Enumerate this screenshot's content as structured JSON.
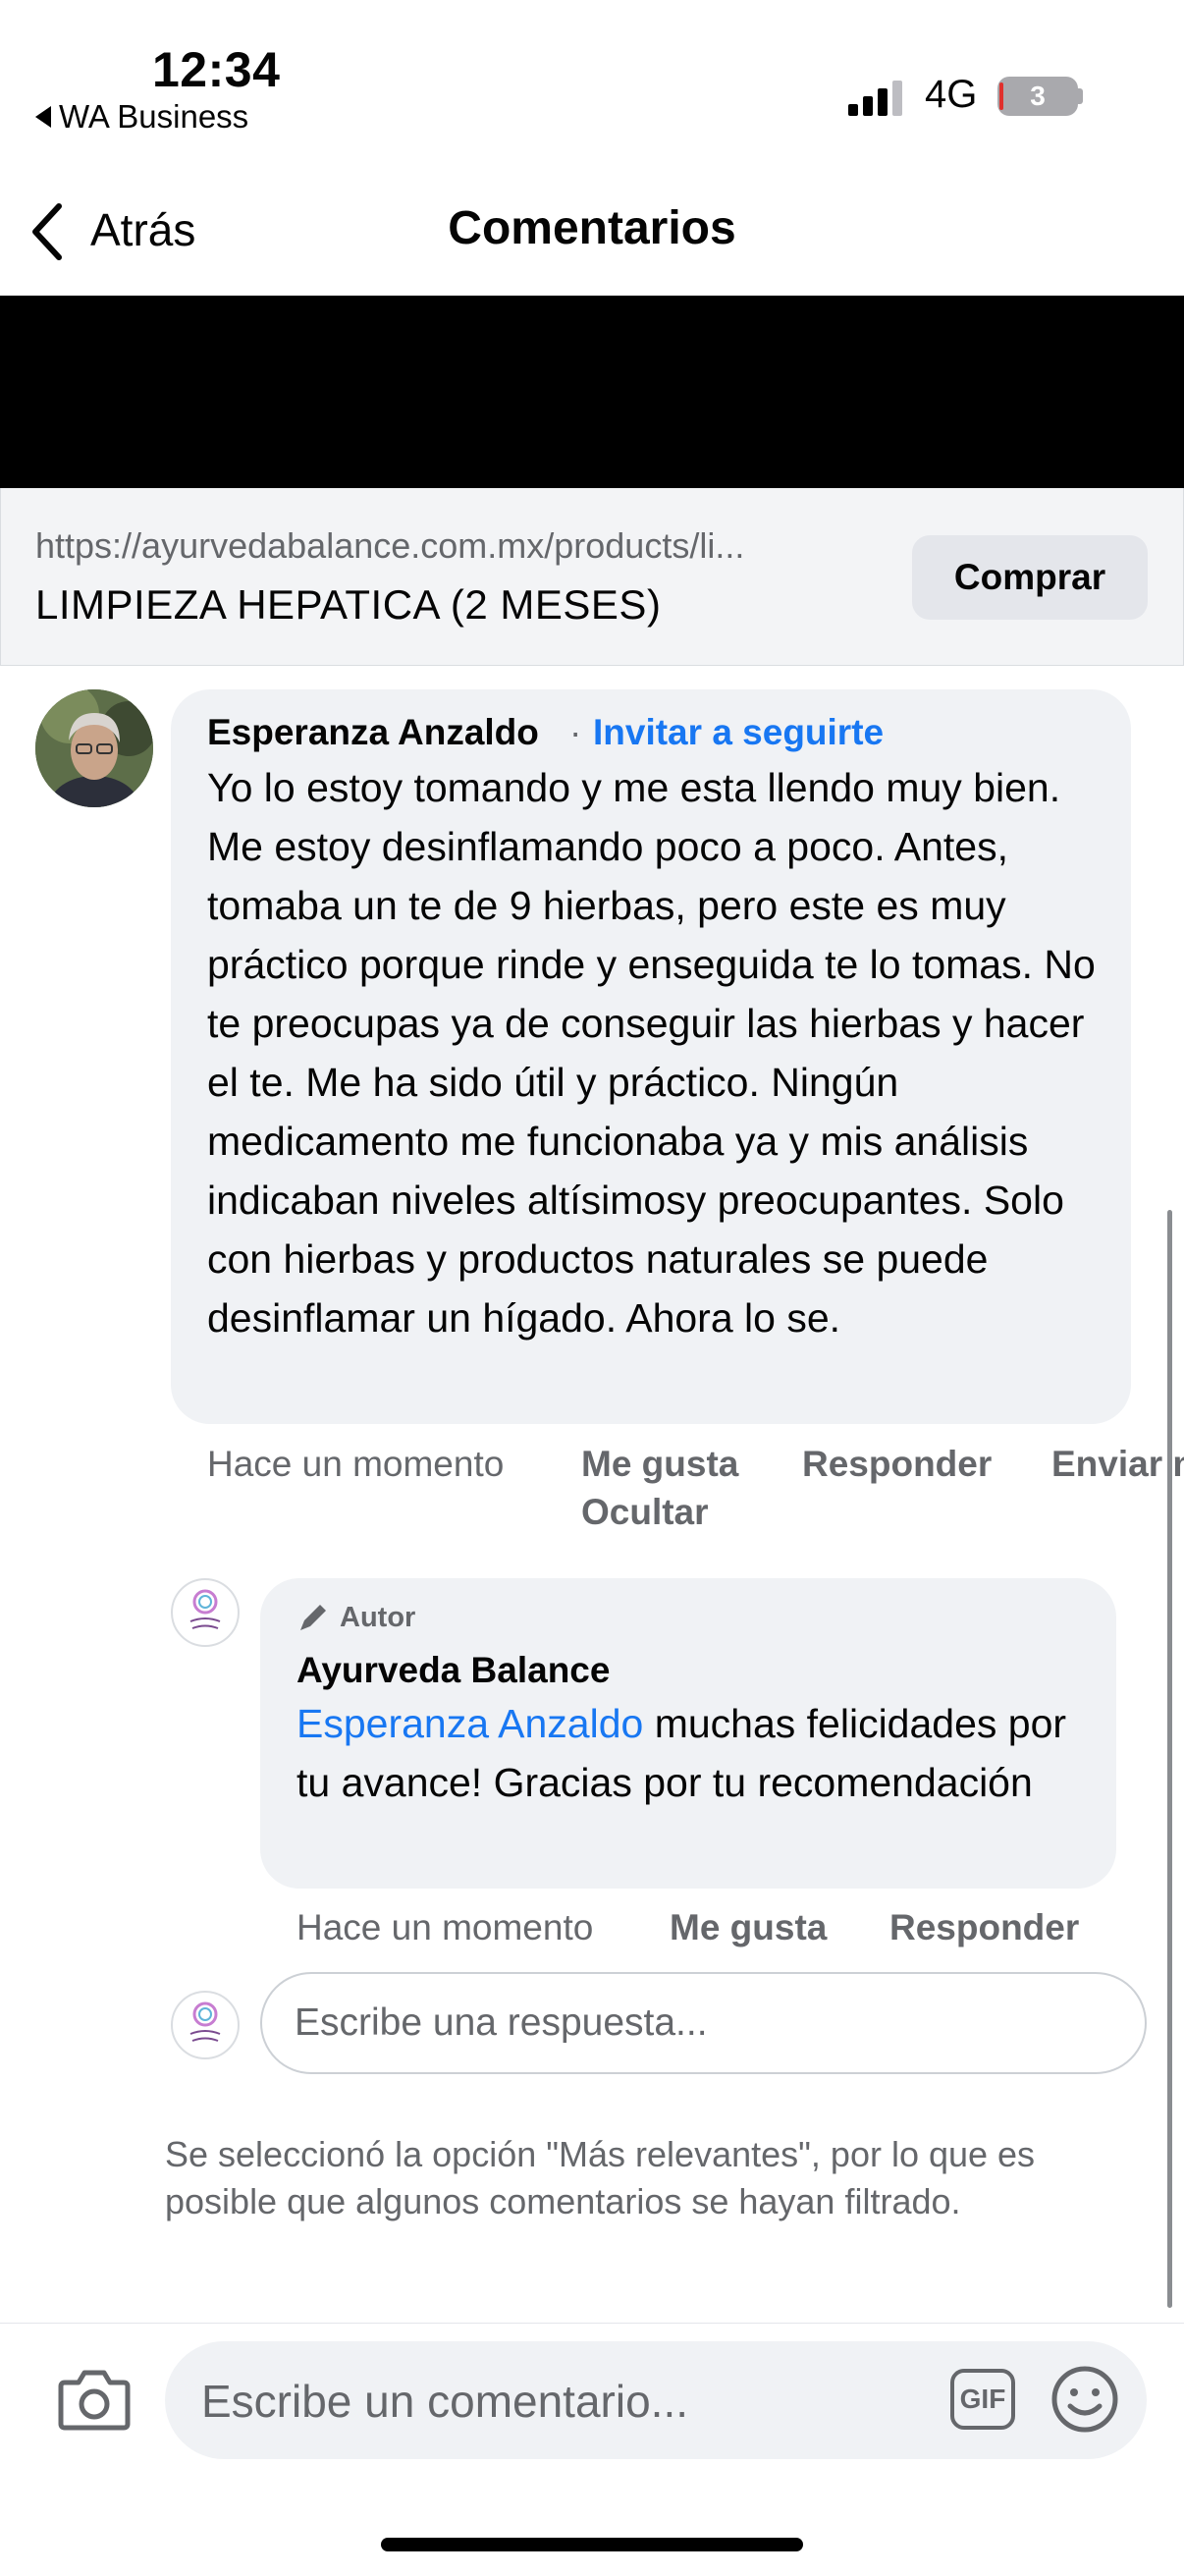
{
  "status_bar": {
    "time": "12:34",
    "back_app": "WA Business",
    "network": "4G",
    "battery": "3"
  },
  "nav": {
    "back_label": "Atrás",
    "title": "Comentarios"
  },
  "link_preview": {
    "url": "https://ayurvedabalance.com.mx/products/li...",
    "title": "LIMPIEZA HEPATICA (2 MESES)",
    "buy_label": "Comprar"
  },
  "comment": {
    "author": "Esperanza Anzaldo",
    "separator": "·",
    "follow_label": "Invitar a seguirte",
    "text": "Yo lo estoy tomando y me esta llendo muy bien.  Me estoy desinflamando poco a poco. Antes, tomaba un te de 9 hierbas, pero este es muy práctico  porque rinde y enseguida te lo tomas. No te preocupas ya de conseguir las hierbas y hacer el te. Me ha sido útil y práctico.  Ningún medicamento me funcionaba ya y mis análisis indicaban niveles altísimosy preocupantes. Solo con hierbas y productos naturales se puede desinflamar un hígado. Ahora lo se.",
    "time": "Hace un momento",
    "actions": {
      "like": "Me gusta",
      "reply": "Responder",
      "send": "Enviar m",
      "hide": "Ocultar"
    }
  },
  "reply": {
    "badge": "Autor",
    "author": "Ayurveda Balance",
    "mention": "Esperanza Anzaldo",
    "text": " muchas felicidades por tu avance! Gracias por tu recomendación",
    "time": "Hace un momento",
    "actions": {
      "like": "Me gusta",
      "reply": "Responder"
    }
  },
  "reply_input": {
    "placeholder": "Escribe una respuesta..."
  },
  "notice": "Se seleccionó la opción \"Más relevantes\", por lo que es posible que algunos comentarios se hayan filtrado.",
  "composer": {
    "placeholder": "Escribe un comentario...",
    "gif_label": "GIF"
  },
  "colors": {
    "link_blue": "#1877f2",
    "bubble_bg": "#f0f2f5",
    "meta_gray": "#65676b"
  },
  "icons": [
    "camera-icon",
    "gif-icon",
    "emoji-icon",
    "chevron-left-icon",
    "pencil-icon",
    "signal-icon"
  ]
}
